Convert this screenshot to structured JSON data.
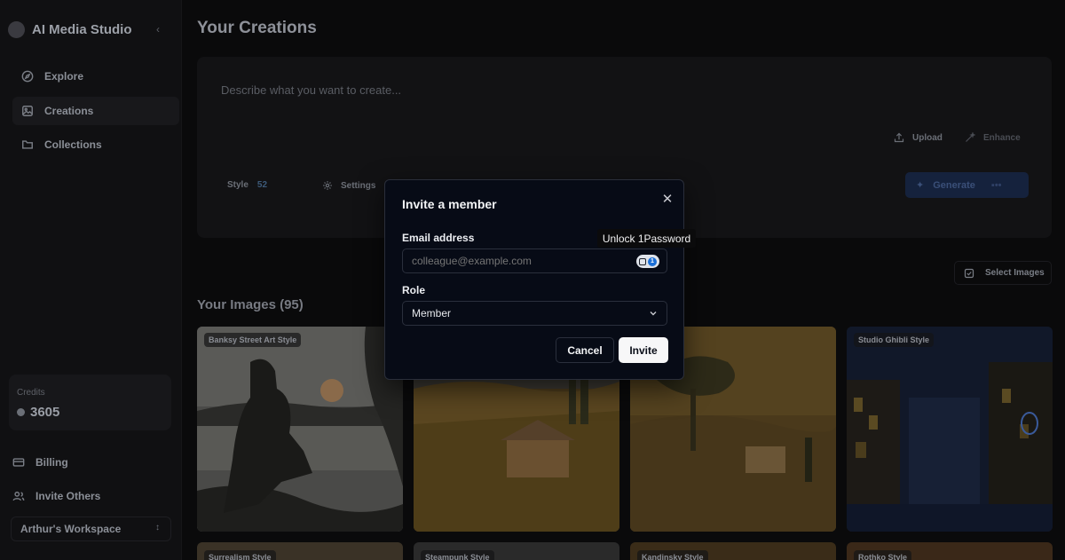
{
  "app": {
    "name": "AI Media Studio"
  },
  "sidebar": {
    "items": [
      {
        "label": "Explore",
        "icon": "compass-icon"
      },
      {
        "label": "Creations",
        "icon": "image-icon"
      },
      {
        "label": "Collections",
        "icon": "folder-icon"
      }
    ],
    "credits": {
      "label": "Credits",
      "value": "3605"
    },
    "billing_label": "Billing",
    "invite_label": "Invite Others",
    "workspace": "Arthur's Workspace"
  },
  "main": {
    "title": "Your Creations",
    "prompt": {
      "placeholder": "Describe what you want to create...",
      "upload_label": "Upload",
      "enhance_label": "Enhance",
      "style_label": "Style",
      "style_count": "52",
      "settings_label": "Settings",
      "generate_label": "Generate"
    },
    "select_images_label": "Select Images",
    "images_title": "Your Images (95)",
    "tiles": [
      {
        "tag": "Banksy Street Art Style"
      },
      {
        "tag": ""
      },
      {
        "tag": ""
      },
      {
        "tag": "Studio Ghibli Style"
      }
    ],
    "tiles_row2": [
      {
        "tag": "Surrealism Style"
      },
      {
        "tag": "Steampunk Style"
      },
      {
        "tag": "Kandinsky Style"
      },
      {
        "tag": "Rothko Style"
      }
    ]
  },
  "modal": {
    "title": "Invite a member",
    "email_label": "Email address",
    "email_placeholder": "colleague@example.com",
    "role_label": "Role",
    "role_value": "Member",
    "cancel_label": "Cancel",
    "invite_label": "Invite"
  },
  "tooltip": "Unlock 1Password",
  "colors": {
    "accent": "#1a6fd8",
    "modal_bg": "#070b16"
  }
}
